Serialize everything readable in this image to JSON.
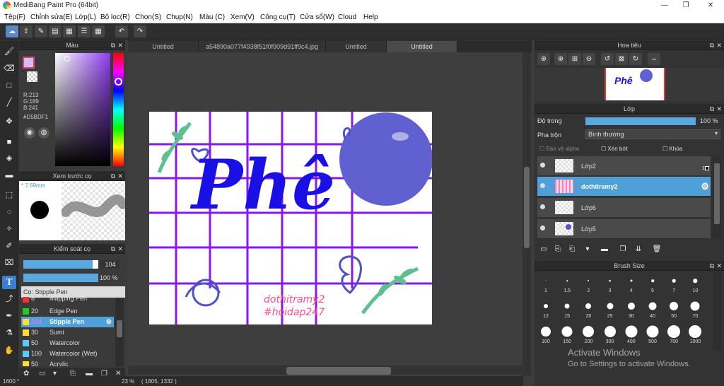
{
  "window": {
    "title": "MediBang Paint Pro (64bit)",
    "min": "—",
    "max": "❐",
    "close": "✕"
  },
  "menu": [
    "Tệp(F)",
    "Chỉnh sửa(E)",
    "Lớp(L)",
    "Bộ lọc(R)",
    "Chọn(S)",
    "Chụp(N)",
    "Màu (C)",
    "Xem(V)",
    "Công cụ(T)",
    "Cửa sổ(W)",
    "Cloud",
    "Help"
  ],
  "color_panel": {
    "title": "Màu",
    "r": "R:213",
    "g": "G:189",
    "b": "B:241",
    "hex": "#D5BDF1",
    "primary": "#d5bdf1"
  },
  "brush_preview": {
    "title": "Xem trước cọ",
    "size": "7.59mm"
  },
  "brush_control": {
    "title": "Kiểm soát cọ",
    "size_value": "104",
    "opacity_value": "100 %"
  },
  "brush_list": {
    "search_placeholder": "Cọ: Stipple Pen",
    "items": [
      {
        "num": "8",
        "name": "Mapping Pen",
        "color": "#e33"
      },
      {
        "num": "20",
        "name": "Edge Pen",
        "color": "#2c2"
      },
      {
        "num": "104",
        "name": "Stipple Pen",
        "color": "#fd3"
      },
      {
        "num": "30",
        "name": "Sumi",
        "color": "#fd3"
      },
      {
        "num": "50",
        "name": "Watercolor",
        "color": "#5cf"
      },
      {
        "num": "100",
        "name": "Watercolor (Wet)",
        "color": "#5cf"
      },
      {
        "num": "50",
        "name": "Acrylic",
        "color": "#fd3"
      }
    ]
  },
  "tabs": [
    "Untitled",
    "a54890a077f4938f51f0f909d91ff9c4.jpg",
    "Untitled",
    "Untitled"
  ],
  "artwork": {
    "text1": "Phê",
    "text2": "dothitramy2",
    "text3": "#hoidap247"
  },
  "navigator": {
    "title": "Hoa tiêu"
  },
  "layer_panel": {
    "title": "Lớp",
    "opacity_label": "Độ trong",
    "opacity_value": "100 %",
    "opacity_fraction": 1.0,
    "blend_label": "Pha trộn",
    "blend_value": "Bình thường",
    "protect_alpha": "Bảo vệ alpha",
    "clip": "Xén bớt",
    "lock": "Khóa",
    "layers": [
      {
        "name": "Lớp2",
        "badge": "1"
      },
      {
        "name": "dothitramy2"
      },
      {
        "name": "Lớp6"
      },
      {
        "name": "Lớp5"
      }
    ]
  },
  "brush_size": {
    "title": "Brush Size",
    "sizes": [
      "1",
      "1.5",
      "2",
      "3",
      "4",
      "5",
      "7",
      "10",
      "12",
      "15",
      "20",
      "25",
      "30",
      "40",
      "50",
      "70",
      "100",
      "150",
      "200",
      "300",
      "400",
      "500",
      "700",
      "1000"
    ]
  },
  "status": {
    "zoom": "1600 *",
    "coords": "( 1805, 1332 )",
    "pct": "23 %"
  },
  "watermark": {
    "line1": "Activate Windows",
    "line2": "Go to Settings to activate Windows."
  }
}
